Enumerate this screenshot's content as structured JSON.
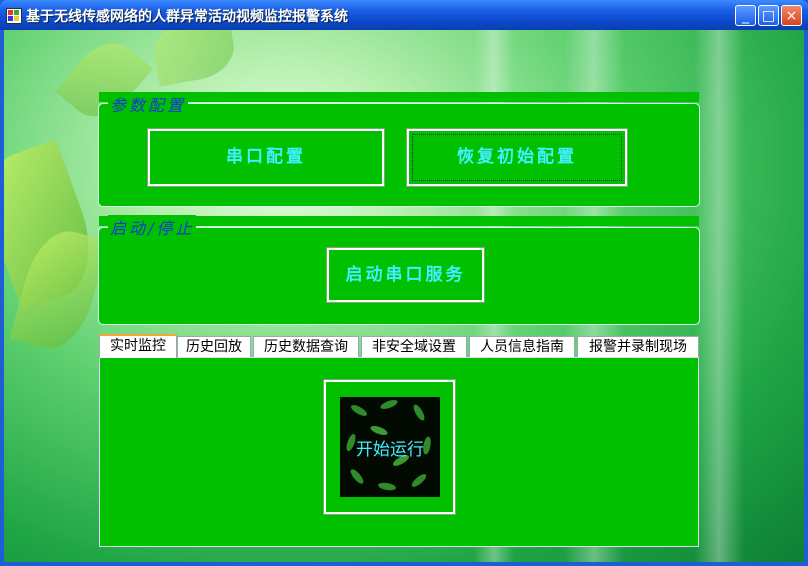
{
  "window": {
    "title": "基于无线传感网络的人群异常活动视频监控报警系统",
    "controls": {
      "minimize": "_",
      "maximize": "□",
      "close": "×"
    }
  },
  "groups": {
    "config": {
      "title": "参数配置",
      "serial_button": "串口配置",
      "restore_button": "恢复初始配置"
    },
    "startstop": {
      "title": "启动/停止",
      "start_service_button": "启动串口服务"
    }
  },
  "tabs": [
    {
      "label": "实时监控",
      "active": true
    },
    {
      "label": "历史回放",
      "active": false
    },
    {
      "label": "历史数据查询",
      "active": false
    },
    {
      "label": "非安全域设置",
      "active": false
    },
    {
      "label": "人员信息指南",
      "active": false
    },
    {
      "label": "报警并录制现场",
      "active": false
    }
  ],
  "panel": {
    "start_button": "开始运行"
  },
  "colors": {
    "panel_green": "#00c000",
    "label_cyan": "#3ff0ff",
    "group_title_blue": "#1537d9"
  }
}
